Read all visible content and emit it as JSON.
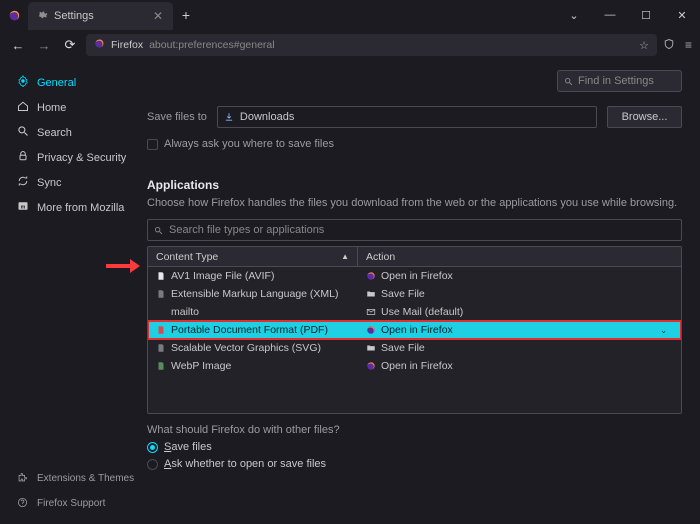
{
  "titlebar": {
    "tab_label": "Settings"
  },
  "url": {
    "brand": "Firefox",
    "address": "about:preferences#general"
  },
  "sidebar": {
    "items": [
      {
        "label": "General",
        "active": true,
        "icon": "gear"
      },
      {
        "label": "Home",
        "active": false,
        "icon": "home"
      },
      {
        "label": "Search",
        "active": false,
        "icon": "search"
      },
      {
        "label": "Privacy & Security",
        "active": false,
        "icon": "lock"
      },
      {
        "label": "Sync",
        "active": false,
        "icon": "sync"
      },
      {
        "label": "More from Mozilla",
        "active": false,
        "icon": "moz"
      }
    ],
    "bottom": [
      {
        "label": "Extensions & Themes"
      },
      {
        "label": "Firefox Support"
      }
    ]
  },
  "find": {
    "placeholder": "Find in Settings"
  },
  "downloads": {
    "save_label": "Save files to",
    "folder": "Downloads",
    "browse": "Browse...",
    "always_ask": "Always ask you where to save files"
  },
  "apps": {
    "title": "Applications",
    "subtitle": "Choose how Firefox handles the files you download from the web or the applications you use while browsing.",
    "search_placeholder": "Search file types or applications",
    "col_type": "Content Type",
    "col_action": "Action",
    "rows": [
      {
        "type": "AV1 Image File (AVIF)",
        "action": "Open in Firefox",
        "icon_type": "file-white",
        "icon_action": "fx",
        "hl": false
      },
      {
        "type": "Extensible Markup Language (XML)",
        "action": "Save File",
        "icon_type": "file-dim",
        "icon_action": "folder",
        "hl": false
      },
      {
        "type": "mailto",
        "action": "Use Mail (default)",
        "icon_type": "none",
        "icon_action": "mail",
        "hl": false
      },
      {
        "type": "Portable Document Format (PDF)",
        "action": "Open in Firefox",
        "icon_type": "pdf",
        "icon_action": "fx",
        "hl": true
      },
      {
        "type": "Scalable Vector Graphics (SVG)",
        "action": "Save File",
        "icon_type": "file-dim",
        "icon_action": "folder",
        "hl": false
      },
      {
        "type": "WebP Image",
        "action": "Open in Firefox",
        "icon_type": "webp",
        "icon_action": "fx",
        "hl": false
      }
    ],
    "question": "What should Firefox do with other files?",
    "opt_save": "ave files",
    "opt_save_prefix": "S",
    "opt_ask": "sk whether to open or save files",
    "opt_ask_prefix": "A"
  }
}
